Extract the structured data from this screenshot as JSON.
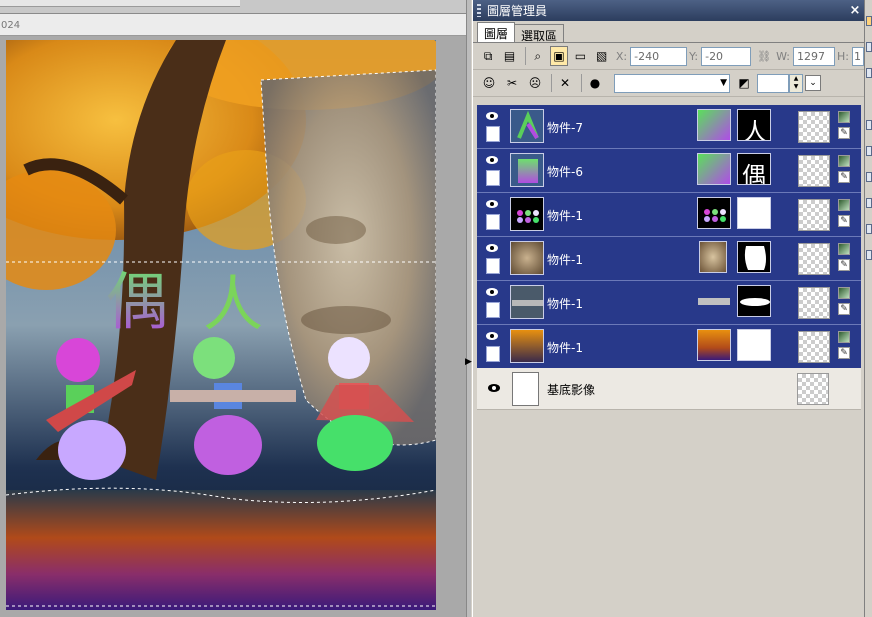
{
  "canvas": {
    "ruler_number": "024",
    "photo_text": {
      "char1": "偶",
      "char2": "人"
    }
  },
  "panel": {
    "title": "圖層管理員",
    "close_glyph": "×",
    "tabs": [
      {
        "label": "圖層",
        "active": true
      },
      {
        "label": "選取區",
        "active": false
      }
    ],
    "toolbar1": {
      "x_label": "X:",
      "x_value": "-240",
      "y_label": "Y:",
      "y_value": "-20",
      "w_label": "W:",
      "w_value": "1297",
      "h_label": "H:",
      "h_value": "1"
    },
    "toolbar2": {
      "combo_value": "",
      "opacity_value": ""
    },
    "layers": [
      {
        "label": "物件-7",
        "thumb": "ren-char",
        "fx": "green-purple",
        "mask": "人"
      },
      {
        "label": "物件-6",
        "thumb": "ou-char",
        "fx": "green-purple",
        "mask": "偶"
      },
      {
        "label": "物件-1",
        "thumb": "dolls",
        "fx": "dolls",
        "mask": ""
      },
      {
        "label": "物件-1",
        "thumb": "face",
        "fx": "face",
        "mask": "blob"
      },
      {
        "label": "物件-1",
        "thumb": "strip",
        "fx": "strip",
        "mask": "strip"
      },
      {
        "label": "物件-1",
        "thumb": "tree",
        "fx": "tree",
        "mask": ""
      }
    ],
    "base_layer": {
      "label": "基底影像"
    }
  },
  "colors": {
    "selected_row": "#28398a",
    "title_bar": "#2c3d5e"
  }
}
